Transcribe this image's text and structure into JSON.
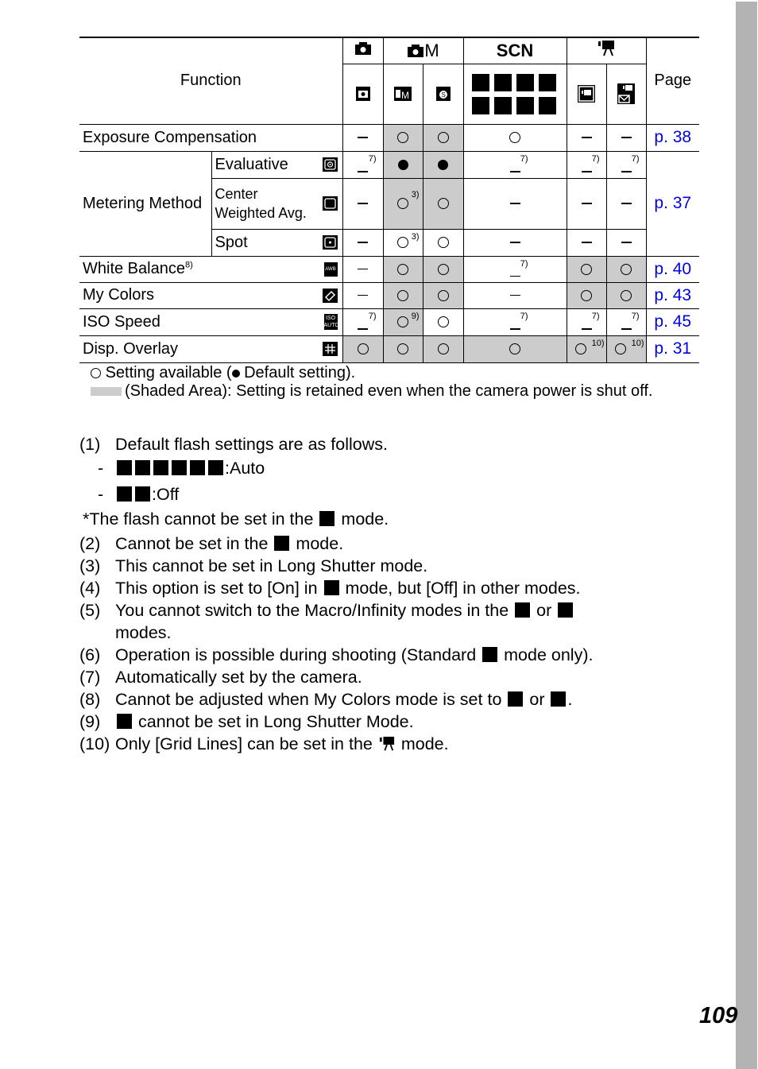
{
  "page_number": "109",
  "table": {
    "header": {
      "function_label": "Function",
      "page_label": "Page",
      "mode_groups": [
        {
          "icon": "camera-auto-icon",
          "span": 1
        },
        {
          "icon": "camera-manual-icon",
          "label": "M",
          "span": 2
        },
        {
          "icon": "scene-icon",
          "label": "SCN",
          "span": 1
        },
        {
          "icon": "movie-icon",
          "span": 2
        }
      ],
      "sub_modes": [
        "auto-mode-icon",
        "manual-mode-icon",
        "digital-macro-icon",
        [
          "portrait-icon",
          "night-snapshot-icon",
          "kids-pets-icon",
          "indoor-icon",
          "foliage-icon",
          "snow-icon",
          "beach-icon",
          "fireworks-icon"
        ],
        "standard-movie-icon",
        "compact-movie-icon"
      ]
    },
    "rows": [
      {
        "function": "Exposure Compensation",
        "cells": [
          "dash",
          "circle",
          "circle",
          "circle",
          "dash",
          "dash"
        ],
        "shaded": [
          false,
          true,
          true,
          false,
          false,
          false
        ],
        "page": "p. 38"
      },
      {
        "group": "Metering Method",
        "function": "Evaluative",
        "icon": "evaluative-metering-icon",
        "cells": [
          "dash:7)",
          "dot",
          "dot",
          "dash:7)",
          "dash:7)",
          "dash:7)"
        ],
        "shaded": [
          false,
          true,
          true,
          false,
          false,
          false
        ],
        "page": "p. 37"
      },
      {
        "group": "Metering Method",
        "function_line1": "Center",
        "function_line2": "Weighted Avg.",
        "icon": "center-weighted-icon",
        "cells": [
          "dash",
          "circle:3)",
          "circle",
          "dash",
          "dash",
          "dash"
        ],
        "shaded": [
          false,
          true,
          true,
          false,
          false,
          false
        ]
      },
      {
        "group": "Metering Method",
        "function": "Spot",
        "icon": "spot-metering-icon",
        "cells": [
          "dash",
          "circle:3)",
          "circle",
          "dash",
          "dash",
          "dash"
        ],
        "shaded": [
          false,
          false,
          false,
          false,
          false,
          false
        ]
      },
      {
        "function": "White Balance",
        "function_sup": "8)",
        "icon": "awb-icon",
        "icon_text": "AWB",
        "cells": [
          "dash",
          "circle",
          "circle",
          "dash:7)",
          "circle",
          "circle"
        ],
        "shaded": [
          false,
          true,
          true,
          false,
          true,
          true
        ],
        "page": "p. 40"
      },
      {
        "function": "My Colors",
        "icon": "my-colors-icon",
        "cells": [
          "dash",
          "circle",
          "circle",
          "dash",
          "circle",
          "circle"
        ],
        "shaded": [
          false,
          true,
          true,
          false,
          true,
          true
        ],
        "page": "p. 43"
      },
      {
        "function": "ISO Speed",
        "icon": "iso-auto-icon",
        "icon_text": "ISO AUTO",
        "cells": [
          "dash:7)",
          "circle:9)",
          "circle",
          "dash:7)",
          "dash:7)",
          "dash:7)"
        ],
        "shaded": [
          false,
          true,
          false,
          false,
          false,
          false
        ],
        "page": "p. 45"
      },
      {
        "function": "Disp. Overlay",
        "icon": "grid-overlay-icon",
        "cells": [
          "circle",
          "circle",
          "circle",
          "circle",
          "circle:10)",
          "circle:10)"
        ],
        "shaded": [
          true,
          true,
          true,
          true,
          true,
          true
        ],
        "page": "p. 31"
      }
    ]
  },
  "legend": {
    "line1_a": "Setting available (",
    "line1_b": "Default setting).",
    "line2": "(Shaded Area): Setting is retained even when the camera power is shut off."
  },
  "notes": [
    {
      "num": "(1)",
      "text": "Default flash settings are as follows."
    },
    {
      "num": "-",
      "icons": [
        "portrait-icon",
        "night-snapshot-icon",
        "kids-pets-icon",
        "indoor-icon",
        "snow-icon",
        "beach-icon"
      ],
      "text": ":Auto"
    },
    {
      "num": "-",
      "icons": [
        "foliage-icon",
        "fireworks-icon"
      ],
      "text": ":Off"
    },
    {
      "num": "",
      "text_a": "*The flash cannot be set in the",
      "icon": "fireworks-icon",
      "text_b": "mode."
    },
    {
      "num": "(2)",
      "text_a": "Cannot be set in the",
      "icon": "fireworks-icon",
      "text_b": "mode."
    },
    {
      "num": "(3)",
      "text": "This cannot be set in Long Shutter mode."
    },
    {
      "num": "(4)",
      "text_a": "This option is set to [On] in",
      "icon": "night-snapshot-icon",
      "text_b": "mode, but [Off] in other modes."
    },
    {
      "num": "(5)",
      "text_a": "You cannot switch to the Macro/Infinity modes in the",
      "icon": "kids-pets-icon",
      "text_mid": "or",
      "icon2": "fireworks-icon",
      "text_b": "modes."
    },
    {
      "num": "(6)",
      "text_a": "Operation is possible during shooting (Standard",
      "icon": "resolution-640-icon",
      "text_b": "mode only)."
    },
    {
      "num": "(7)",
      "text": "Automatically set by the camera."
    },
    {
      "num": "(8)",
      "text_a": "Cannot be adjusted when My Colors mode is set to",
      "icon": "sepia-icon",
      "text_mid": "or",
      "icon2": "bw-icon",
      "text_b": "."
    },
    {
      "num": "(9)",
      "icon": "iso-auto-icon",
      "text_b": "cannot be set in Long Shutter Mode."
    },
    {
      "num": "(10)",
      "text_a": "Only [Grid Lines] can be set in the",
      "icon": "movie-icon",
      "text_b": "mode."
    }
  ]
}
